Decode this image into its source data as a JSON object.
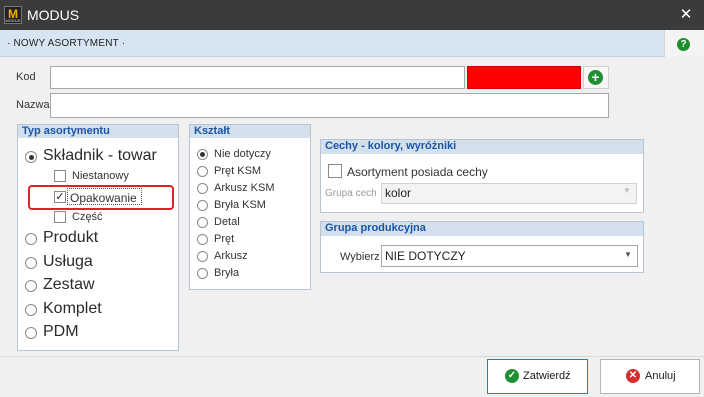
{
  "window": {
    "logo_letter": "M",
    "logo_sub": "MODUS",
    "title": "MODUS",
    "close_glyph": "✕"
  },
  "header": {
    "label": "· NOWY ASORTYMENT ·",
    "help_glyph": "?"
  },
  "form": {
    "kod_label": "Kod",
    "kod_value": "",
    "kod_color": "#ff0000",
    "add_glyph": "+",
    "nazwa_label": "Nazwa",
    "nazwa_value": ""
  },
  "typ": {
    "title": "Typ asortymentu",
    "skladnik": "Składnik - towar",
    "sub_items": [
      {
        "label": "Niestanowy",
        "checked": false
      },
      {
        "label": "Opakowanie",
        "checked": true
      },
      {
        "label": "Część",
        "checked": false
      }
    ],
    "options": [
      {
        "label": "Produkt"
      },
      {
        "label": "Usługa"
      },
      {
        "label": "Zestaw"
      },
      {
        "label": "Komplet"
      },
      {
        "label": "PDM"
      }
    ],
    "selected": "Składnik - towar"
  },
  "ksztalt": {
    "title": "Kształt",
    "options": [
      "Nie dotyczy",
      "Pręt KSM",
      "Arkusz KSM",
      "Bryła KSM",
      "Detal",
      "Pręt",
      "Arkusz",
      "Bryła"
    ],
    "selected": "Nie dotyczy"
  },
  "cechy": {
    "title": "Cechy - kolory, wyróżniki",
    "checkbox_label": "Asortyment posiada cechy",
    "checked": false,
    "grupa_label": "Grupa cech",
    "grupa_value": "kolor"
  },
  "grupa_prod": {
    "title": "Grupa produkcyjna",
    "label": "Wybierz",
    "value": "NIE DOTYCZY"
  },
  "footer": {
    "ok_label": "Zatwierdź",
    "cancel_label": "Anuluj",
    "ok_color": "#1f8f31",
    "cancel_color": "#d32f2f"
  }
}
